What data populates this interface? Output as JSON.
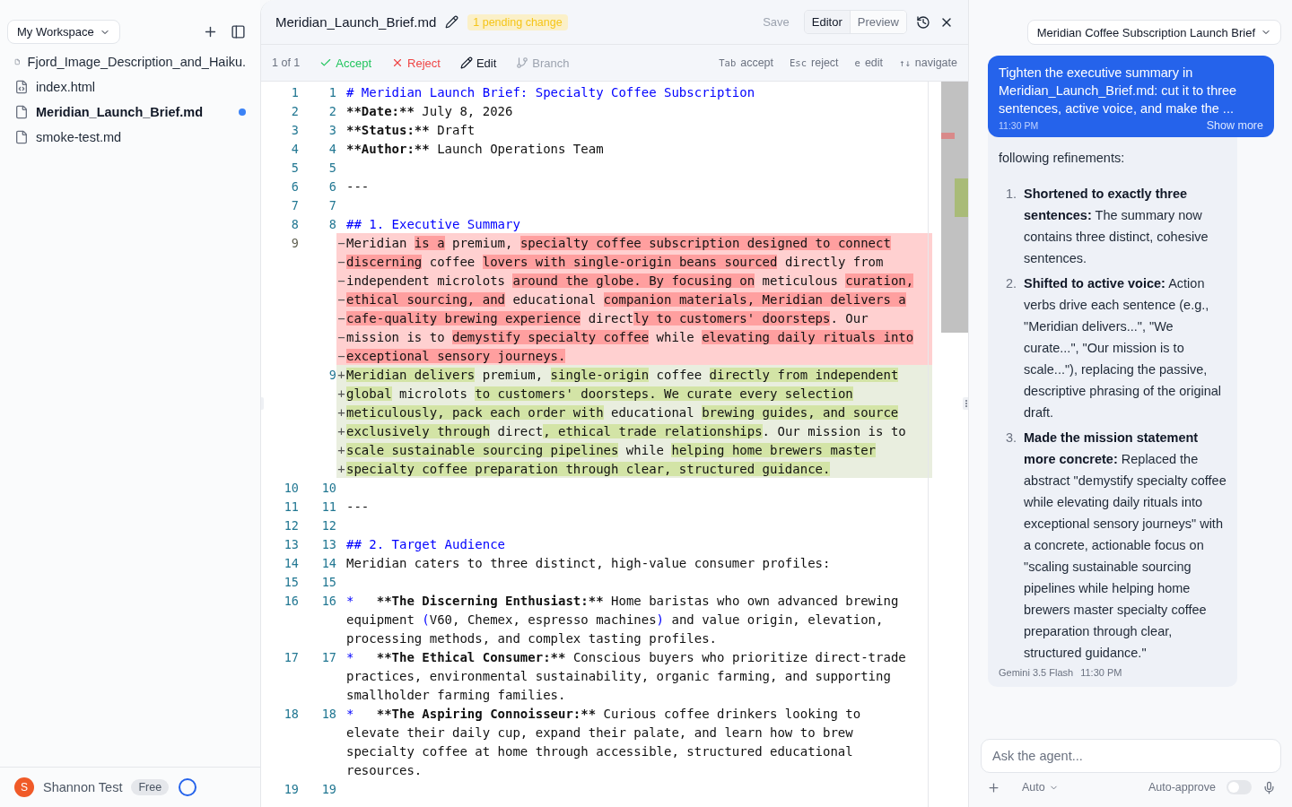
{
  "sidebar": {
    "workspace": "My Workspace",
    "files": [
      {
        "name": "Fjord_Image_Description_and_Haiku.",
        "kind": "text",
        "selected": false,
        "modified": false
      },
      {
        "name": "index.html",
        "kind": "code",
        "selected": false,
        "modified": false
      },
      {
        "name": "Meridian_Launch_Brief.md",
        "kind": "text",
        "selected": true,
        "modified": true
      },
      {
        "name": "smoke-test.md",
        "kind": "text",
        "selected": false,
        "modified": false
      }
    ],
    "user": {
      "initial": "S",
      "name": "Shannon Test",
      "plan": "Free"
    }
  },
  "editor": {
    "file_name": "Meridian_Launch_Brief.md",
    "pending_badge": "1 pending change",
    "save": {
      "label": "Save",
      "disabled": true
    },
    "view_tabs": [
      {
        "label": "Editor",
        "selected": true
      },
      {
        "label": "Preview",
        "selected": false
      }
    ],
    "toolbar": {
      "counter": "1 of 1",
      "actions": [
        {
          "kind": "accept",
          "label": "Accept",
          "disabled": false
        },
        {
          "kind": "reject",
          "label": "Reject",
          "disabled": false
        },
        {
          "kind": "edit",
          "label": "Edit",
          "disabled": false
        },
        {
          "kind": "branch",
          "label": "Branch",
          "disabled": true
        }
      ],
      "hints": [
        {
          "key": "Tab",
          "label": "accept"
        },
        {
          "key": "Esc",
          "label": "reject"
        },
        {
          "key": "e",
          "label": "edit"
        },
        {
          "key": "↑↓",
          "label": "navigate"
        }
      ]
    },
    "lines": [
      {
        "kind": "context",
        "old": "1",
        "new": "1",
        "rows": [
          {
            "segments": [
              {
                "text": "# Meridian Launch Brief: Specialty Coffee Subscription",
                "kind": "heading"
              }
            ]
          }
        ]
      },
      {
        "kind": "context",
        "old": "2",
        "new": "2",
        "rows": [
          {
            "segments": [
              {
                "text": "**Date:**",
                "kind": "strong"
              },
              {
                "text": " July 8, 2026",
                "kind": "plain"
              }
            ]
          }
        ]
      },
      {
        "kind": "context",
        "old": "3",
        "new": "3",
        "rows": [
          {
            "segments": [
              {
                "text": "**Status:**",
                "kind": "strong"
              },
              {
                "text": " Draft",
                "kind": "plain"
              }
            ]
          }
        ]
      },
      {
        "kind": "context",
        "old": "4",
        "new": "4",
        "rows": [
          {
            "segments": [
              {
                "text": "**Author:**",
                "kind": "strong"
              },
              {
                "text": " Launch Operations Team",
                "kind": "plain"
              }
            ]
          }
        ]
      },
      {
        "kind": "context",
        "old": "5",
        "new": "5",
        "rows": [
          {
            "segments": []
          }
        ]
      },
      {
        "kind": "context",
        "old": "6",
        "new": "6",
        "rows": [
          {
            "segments": [
              {
                "text": "---",
                "kind": "plain"
              }
            ]
          }
        ]
      },
      {
        "kind": "context",
        "old": "7",
        "new": "7",
        "rows": [
          {
            "segments": []
          }
        ]
      },
      {
        "kind": "context",
        "old": "8",
        "new": "8",
        "rows": [
          {
            "segments": [
              {
                "text": "## 1. Executive Summary",
                "kind": "heading"
              }
            ]
          }
        ]
      },
      {
        "kind": "removed",
        "old": "9",
        "rows": [
          {
            "marker": "−",
            "segments": [
              {
                "text": "Meridian ",
                "kind": "plain"
              },
              {
                "text": "is a",
                "kind": "changed"
              },
              {
                "text": " premium, ",
                "kind": "plain"
              },
              {
                "text": "specialty coffee subscription designed to connect",
                "kind": "changed"
              }
            ]
          },
          {
            "marker": "−",
            "segments": [
              {
                "text": "discerning",
                "kind": "changed"
              },
              {
                "text": " coffee ",
                "kind": "plain"
              },
              {
                "text": "lovers with single-origin beans sourced",
                "kind": "changed"
              },
              {
                "text": " directly from",
                "kind": "plain"
              }
            ]
          },
          {
            "marker": "−",
            "segments": [
              {
                "text": "independent microlots ",
                "kind": "plain"
              },
              {
                "text": "around the globe. By focusing on",
                "kind": "changed"
              },
              {
                "text": " meticulous ",
                "kind": "plain"
              },
              {
                "text": "curation,",
                "kind": "changed"
              }
            ]
          },
          {
            "marker": "−",
            "segments": [
              {
                "text": "ethical sourcing, and",
                "kind": "changed"
              },
              {
                "text": " educational ",
                "kind": "plain"
              },
              {
                "text": "companion materials, Meridian delivers a",
                "kind": "changed"
              }
            ]
          },
          {
            "marker": "−",
            "segments": [
              {
                "text": "cafe-quality brewing experience",
                "kind": "changed"
              },
              {
                "text": " direct",
                "kind": "plain"
              },
              {
                "text": "ly to customers' doorsteps",
                "kind": "changed"
              },
              {
                "text": ". Our",
                "kind": "plain"
              }
            ]
          },
          {
            "marker": "−",
            "segments": [
              {
                "text": "mission is to ",
                "kind": "plain"
              },
              {
                "text": "demystify specialty coffee",
                "kind": "changed"
              },
              {
                "text": " while ",
                "kind": "plain"
              },
              {
                "text": "elevating daily rituals into",
                "kind": "changed"
              }
            ]
          },
          {
            "marker": "−",
            "segments": [
              {
                "text": "exceptional sensory journeys.",
                "kind": "changed"
              }
            ]
          }
        ]
      },
      {
        "kind": "added",
        "new": "9",
        "rows": [
          {
            "marker": "+",
            "segments": [
              {
                "text": "Meridian delivers",
                "kind": "changed"
              },
              {
                "text": " premium, ",
                "kind": "plain"
              },
              {
                "text": "single-origin",
                "kind": "changed"
              },
              {
                "text": " coffee ",
                "kind": "plain"
              },
              {
                "text": "directly from independent",
                "kind": "changed"
              }
            ]
          },
          {
            "marker": "+",
            "segments": [
              {
                "text": "global",
                "kind": "changed"
              },
              {
                "text": " microlots ",
                "kind": "plain"
              },
              {
                "text": "to customers' doorsteps. We curate every selection",
                "kind": "changed"
              }
            ]
          },
          {
            "marker": "+",
            "segments": [
              {
                "text": "meticulously, pack each order with",
                "kind": "changed"
              },
              {
                "text": " educational ",
                "kind": "plain"
              },
              {
                "text": "brewing guides, and source",
                "kind": "changed"
              }
            ]
          },
          {
            "marker": "+",
            "segments": [
              {
                "text": "exclusively through",
                "kind": "changed"
              },
              {
                "text": " direct",
                "kind": "plain"
              },
              {
                "text": ", ethical trade relationships",
                "kind": "changed"
              },
              {
                "text": ". Our mission is to",
                "kind": "plain"
              }
            ]
          },
          {
            "marker": "+",
            "segments": [
              {
                "text": "scale sustainable sourcing pipelines",
                "kind": "changed"
              },
              {
                "text": " while ",
                "kind": "plain"
              },
              {
                "text": "helping home brewers master",
                "kind": "changed"
              }
            ]
          },
          {
            "marker": "+",
            "segments": [
              {
                "text": "specialty coffee preparation through clear, structured guidance.",
                "kind": "changed"
              }
            ]
          }
        ]
      },
      {
        "kind": "context",
        "old": "10",
        "new": "10",
        "rows": [
          {
            "segments": []
          }
        ]
      },
      {
        "kind": "context",
        "old": "11",
        "new": "11",
        "rows": [
          {
            "segments": [
              {
                "text": "---",
                "kind": "plain"
              }
            ]
          }
        ]
      },
      {
        "kind": "context",
        "old": "12",
        "new": "12",
        "rows": [
          {
            "segments": []
          }
        ]
      },
      {
        "kind": "context",
        "old": "13",
        "new": "13",
        "rows": [
          {
            "segments": [
              {
                "text": "## 2. Target Audience",
                "kind": "heading"
              }
            ]
          }
        ]
      },
      {
        "kind": "context",
        "old": "14",
        "new": "14",
        "rows": [
          {
            "segments": [
              {
                "text": "Meridian caters to three distinct, high-value consumer profiles:",
                "kind": "plain"
              }
            ]
          }
        ]
      },
      {
        "kind": "context",
        "old": "15",
        "new": "15",
        "rows": [
          {
            "segments": []
          }
        ]
      },
      {
        "kind": "context",
        "old": "16",
        "new": "16",
        "rows": [
          {
            "segments": [
              {
                "text": "*",
                "kind": "markup"
              },
              {
                "text": "   **The Discerning Enthusiast:**",
                "kind": "strong"
              },
              {
                "text": " Home baristas who own advanced brewing",
                "kind": "plain"
              }
            ]
          },
          {
            "segments": [
              {
                "text": "equipment ",
                "kind": "plain"
              },
              {
                "text": "(",
                "kind": "markup"
              },
              {
                "text": "V60, Chemex, espresso machines",
                "kind": "plain"
              },
              {
                "text": ")",
                "kind": "markup"
              },
              {
                "text": " and value origin, elevation,",
                "kind": "plain"
              }
            ]
          },
          {
            "segments": [
              {
                "text": "processing methods, and complex tasting profiles.",
                "kind": "plain"
              }
            ]
          }
        ]
      },
      {
        "kind": "context",
        "old": "17",
        "new": "17",
        "rows": [
          {
            "segments": [
              {
                "text": "*",
                "kind": "markup"
              },
              {
                "text": "   **The Ethical Consumer:**",
                "kind": "strong"
              },
              {
                "text": " Conscious buyers who prioritize direct-trade",
                "kind": "plain"
              }
            ]
          },
          {
            "segments": [
              {
                "text": "practices, environmental sustainability, organic farming, and supporting",
                "kind": "plain"
              }
            ]
          },
          {
            "segments": [
              {
                "text": "smallholder farming families.",
                "kind": "plain"
              }
            ]
          }
        ]
      },
      {
        "kind": "context",
        "old": "18",
        "new": "18",
        "rows": [
          {
            "segments": [
              {
                "text": "*",
                "kind": "markup"
              },
              {
                "text": "   **The Aspiring Connoisseur:**",
                "kind": "strong"
              },
              {
                "text": " Curious coffee drinkers looking to",
                "kind": "plain"
              }
            ]
          },
          {
            "segments": [
              {
                "text": "elevate their daily cup, expand their palate, and learn how to brew",
                "kind": "plain"
              }
            ]
          },
          {
            "segments": [
              {
                "text": "specialty coffee at home through accessible, structured educational",
                "kind": "plain"
              }
            ]
          },
          {
            "segments": [
              {
                "text": "resources.",
                "kind": "plain"
              }
            ]
          }
        ]
      },
      {
        "kind": "context",
        "old": "19",
        "new": "19",
        "rows": [
          {
            "segments": []
          }
        ]
      }
    ]
  },
  "chat": {
    "conversation": "Meridian Coffee Subscription Launch Brief",
    "user_message": {
      "text": "Tighten the executive summary in Meridian_Launch_Brief.md: cut it to three sentences, active voice, and make the ...",
      "time": "11:30 PM",
      "show_more": "Show more"
    },
    "agent_message": {
      "intro": "following refinements:",
      "items": [
        {
          "number": "1.",
          "text": "**Shortened to exactly three sentences:** The summary now contains three distinct, cohesive sentences."
        },
        {
          "number": "2.",
          "text": "**Shifted to active voice:** Action verbs drive each sentence (e.g., \"Meridian delivers...\", \"We curate...\", \"Our mission is to scale...\"), replacing the passive, descriptive phrasing of the original draft."
        },
        {
          "number": "3.",
          "text": "**Made the mission statement more concrete:** Replaced the abstract \"demystify specialty coffee while elevating daily rituals into exceptional sensory journeys\" with a concrete, actionable focus on \"scaling sustainable sourcing pipelines while helping home brewers master specialty coffee preparation through clear, structured guidance.\""
        }
      ],
      "model": "Gemini 3.5 Flash",
      "time": "11:30 PM"
    },
    "input": {
      "placeholder": "Ask the agent..."
    },
    "mode": "Auto",
    "auto_approve": {
      "label": "Auto-approve",
      "on": false
    }
  }
}
